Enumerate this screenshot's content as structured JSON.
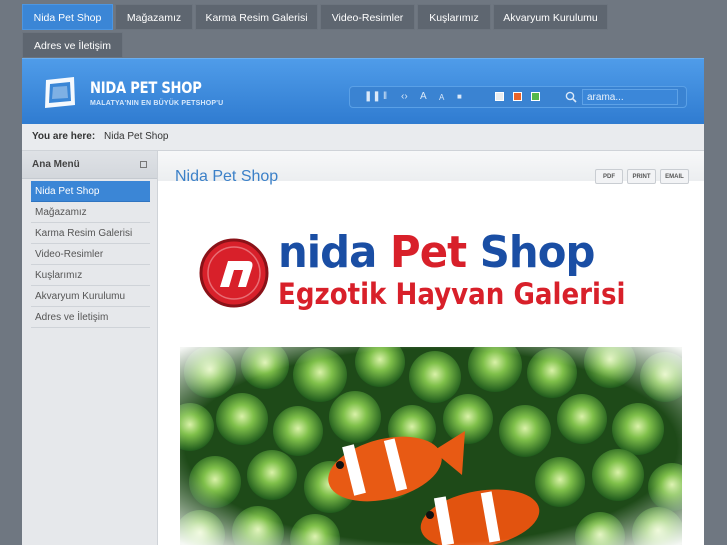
{
  "nav": {
    "items": [
      {
        "label": "Nida Pet Shop",
        "active": true
      },
      {
        "label": "Mağazamız",
        "active": false
      },
      {
        "label": "Karma Resim Galerisi",
        "active": false
      },
      {
        "label": "Video-Resimler",
        "active": false
      },
      {
        "label": "Kuşlarımız",
        "active": false
      },
      {
        "label": "Akvaryum Kurulumu",
        "active": false
      },
      {
        "label": "Adres ve İletişim",
        "active": false
      }
    ]
  },
  "header": {
    "title": "NIDA PET SHOP",
    "subtitle": "MALATYA'NIN EN BÜYÜK PETSHOP'U",
    "search_placeholder": "arama...",
    "font_toolbar_icons": [
      "pause-icon",
      "columns-icon",
      "code-icon",
      "font-large-icon",
      "font-small-icon",
      "square-icon"
    ],
    "color_swatches": [
      "#e8ecf0",
      "#e8632a",
      "#55b84a"
    ]
  },
  "breadcrumb": {
    "label": "You are here:",
    "current": "Nida Pet Shop"
  },
  "sidebar": {
    "title": "Ana Menü",
    "items": [
      {
        "label": "Nida Pet Shop",
        "active": true
      },
      {
        "label": "Mağazamız",
        "active": false
      },
      {
        "label": "Karma Resim Galerisi",
        "active": false
      },
      {
        "label": "Video-Resimler",
        "active": false
      },
      {
        "label": "Kuşlarımız",
        "active": false
      },
      {
        "label": "Akvaryum Kurulumu",
        "active": false
      },
      {
        "label": "Adres ve İletişim",
        "active": false
      }
    ]
  },
  "article": {
    "title": "Nida Pet Shop",
    "pdf_label": "PDF",
    "print_label": "PRINT",
    "email_label": "EMAIL"
  },
  "banner": {
    "line1_a": "nida",
    "line1_b": "Pet",
    "line1_c": "Shop",
    "line2": "Egzotik Hayvan Galerisi"
  },
  "colors": {
    "accent": "#3b86d6",
    "banner_blue": "#1a4ea4",
    "banner_red": "#d8202a"
  }
}
